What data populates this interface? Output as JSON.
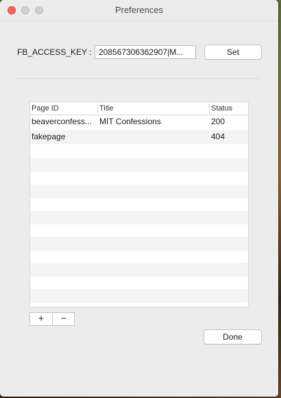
{
  "window": {
    "title": "Preferences"
  },
  "access_key": {
    "label": "FB_ACCESS_KEY :",
    "value": "208567306362907|M..."
  },
  "buttons": {
    "set": "Set",
    "done": "Done",
    "add": "+",
    "remove": "−"
  },
  "table": {
    "columns": [
      "Page ID",
      "Title",
      "Status"
    ],
    "rows": [
      {
        "page_id": "beaverconfess...",
        "title": "MIT Confessions",
        "status": "200"
      },
      {
        "page_id": "fakepage",
        "title": "",
        "status": "404"
      }
    ]
  }
}
